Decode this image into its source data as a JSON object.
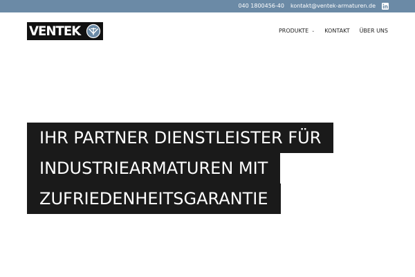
{
  "topbar": {
    "phone": "040 1800456-40",
    "email": "kontakt@ventek-armaturen.de",
    "social_icon": "linkedin-icon",
    "background_color": "#6b8aa6"
  },
  "header": {
    "logo_text": "VENTEK",
    "logo_mark_icon": "valve-icon"
  },
  "nav": {
    "items": [
      {
        "label": "PRODUKTE",
        "has_dropdown": true
      },
      {
        "label": "KONTAKT",
        "has_dropdown": false
      },
      {
        "label": "ÜBER UNS",
        "has_dropdown": false
      }
    ]
  },
  "hero": {
    "lines": [
      "IHR PARTNER DIENSTLEISTER FÜR",
      "INDUSTRIEARMATUREN MIT",
      "ZUFRIEDENHEITSGARANTIE"
    ],
    "background_color": "#1a1a1a"
  }
}
